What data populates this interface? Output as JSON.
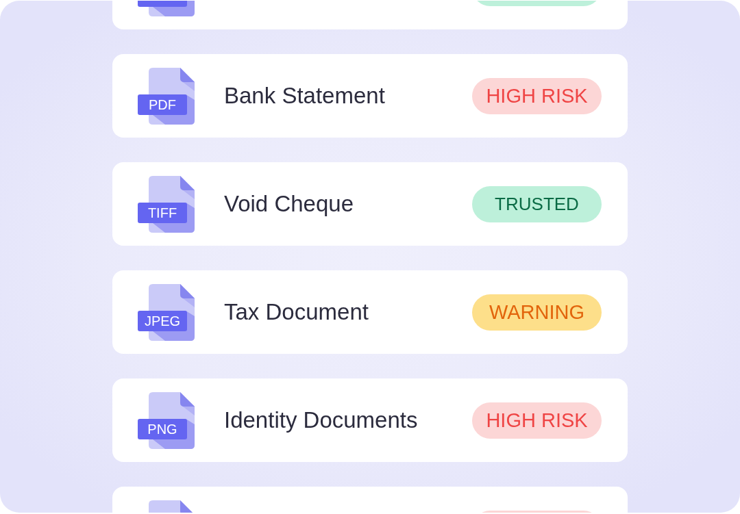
{
  "documents": [
    {
      "kind": "trusted"
    },
    {
      "name": "Bank Statement",
      "file_type": "PDF",
      "kind": "high_risk",
      "badge": "HIGH RISK"
    },
    {
      "name": "Void Cheque",
      "file_type": "TIFF",
      "kind": "trusted",
      "badge": "TRUSTED"
    },
    {
      "name": "Tax Document",
      "file_type": "JPEG",
      "kind": "warning",
      "badge": "WARNING"
    },
    {
      "name": "Identity Documents",
      "file_type": "PNG",
      "kind": "high_risk",
      "badge": "HIGH RISK"
    },
    {
      "kind": "high_risk"
    }
  ]
}
